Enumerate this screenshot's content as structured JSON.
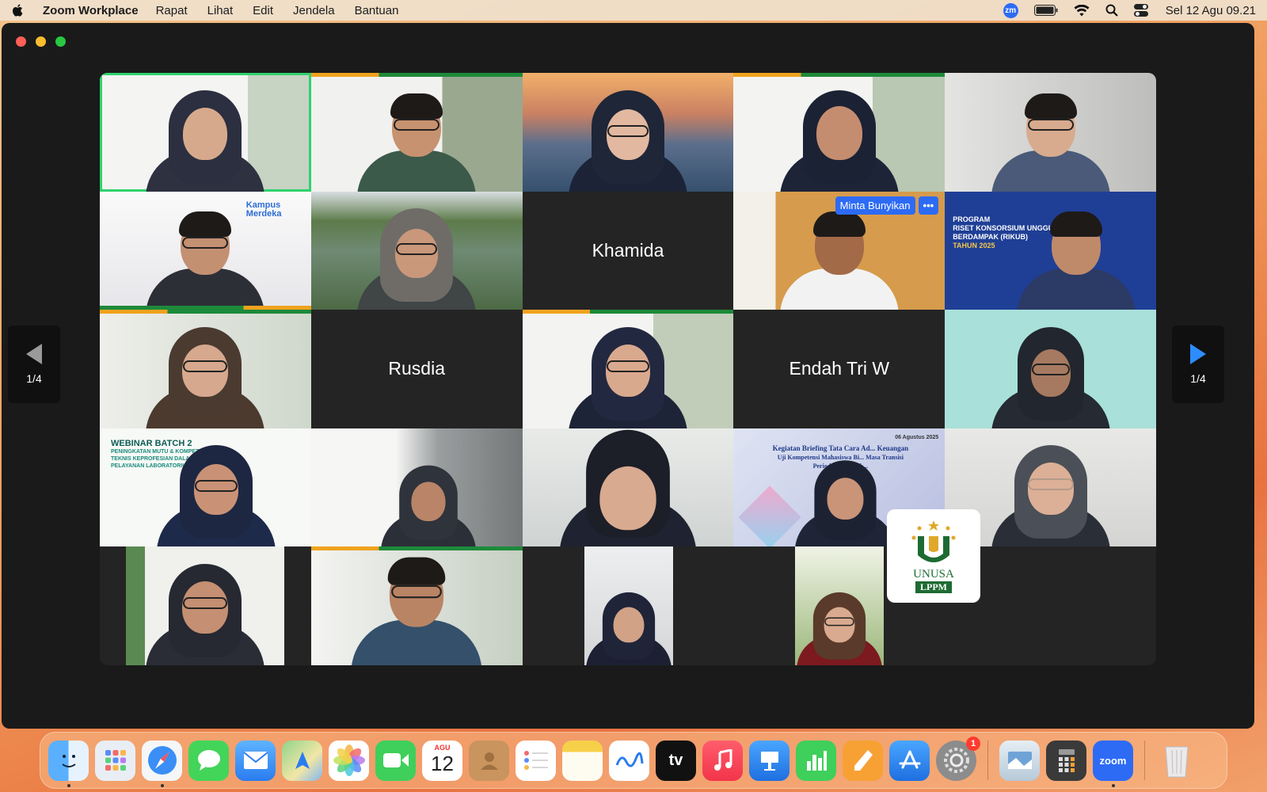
{
  "menubar": {
    "app_name": "Zoom Workplace",
    "menus": [
      "Rapat",
      "Lihat",
      "Edit",
      "Jendela",
      "Bantuan"
    ],
    "zoom_status_icon": "zm",
    "clock": "Sel 12 Agu  09.21"
  },
  "meeting": {
    "page_indicator_prev": "1/4",
    "page_indicator_next": "1/4",
    "tiles": [
      {
        "kind": "video",
        "speaking": true
      },
      {
        "kind": "video"
      },
      {
        "kind": "video"
      },
      {
        "kind": "video"
      },
      {
        "kind": "video"
      },
      {
        "kind": "video"
      },
      {
        "kind": "video"
      },
      {
        "kind": "name",
        "name": "Khamida"
      },
      {
        "kind": "video",
        "request_label": "Minta Bunyikan",
        "more_label": "•••"
      },
      {
        "kind": "video"
      },
      {
        "kind": "video"
      },
      {
        "kind": "name",
        "name": "Rusdia"
      },
      {
        "kind": "video"
      },
      {
        "kind": "name",
        "name": "Endah Tri W"
      },
      {
        "kind": "video"
      },
      {
        "kind": "video"
      },
      {
        "kind": "video"
      },
      {
        "kind": "video"
      },
      {
        "kind": "video"
      },
      {
        "kind": "video"
      },
      {
        "kind": "video"
      },
      {
        "kind": "video"
      },
      {
        "kind": "video"
      },
      {
        "kind": "video"
      },
      {
        "kind": "logo"
      }
    ],
    "slides": {
      "merdeka": "Kampus Merdeka",
      "rikub": [
        "PROGRAM",
        "RISET KONSORSIUM UNGGULAN",
        "BERDAMPAK (RIKUB)",
        "TAHUN 2025"
      ],
      "webinar": [
        "WEBINAR BATCH 2",
        "PENINGKATAN MUTU & KOMPETENSI",
        "TEKNIS KEPROFESIAN DALAM",
        "PELAYANAN LABORATORIUM MEDIK"
      ],
      "briefing_date": "06 Agustus 2025",
      "briefing": [
        "Kegiatan Briefing Tata Cara Ad... Keuangan",
        "Uji Kompetensi Mahasiswa Bi... Masa Transisi",
        "Periode II Gelomb..."
      ]
    },
    "logo": {
      "text": "UNUSA",
      "sub": "LPPM"
    }
  },
  "dock": {
    "calendar_month": "AGU",
    "calendar_day": "12",
    "settings_badge": "1",
    "tv_label": "tv",
    "zoom_label": "zoom"
  }
}
